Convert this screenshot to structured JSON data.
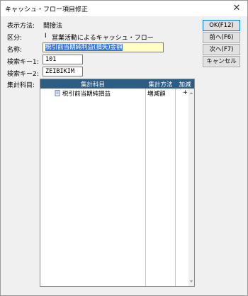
{
  "window": {
    "title": "キャッシュ・フロー項目修正",
    "close_glyph": "✕"
  },
  "form": {
    "display_method_label": "表示方法:",
    "display_method_value": "間接法",
    "category_label": "区分:",
    "category_marker": "Ⅰ",
    "category_value": "営業活動によるキャッシュ・フロー",
    "name_label": "名称:",
    "name_value": "税引前当期純利益(損失)金額",
    "key1_label": "検索キー1:",
    "key1_value": "101",
    "key2_label": "検索キー2:",
    "key2_value": "ZEIBIKIM",
    "items_label": "集計科目:"
  },
  "buttons": {
    "ok": "OK(F12)",
    "prev": "前へ(F6)",
    "next": "次へ(F7)",
    "cancel": "キャンセル"
  },
  "grid": {
    "columns": [
      "集計科目",
      "集計方法",
      "加減"
    ],
    "rows": [
      {
        "icon": "document-icon",
        "item": "税引前当期純損益",
        "method": "増減額",
        "sign": "+"
      }
    ]
  },
  "colors": {
    "header_bg": "#2e5d83",
    "name_field_bg": "#ffffc6",
    "selection": "#3a78d8"
  }
}
